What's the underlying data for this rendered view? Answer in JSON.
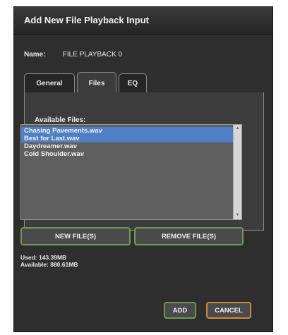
{
  "dialog": {
    "title": "Add New File Playback Input",
    "name_label": "Name:",
    "name_value": "FILE PLAYBACK 0",
    "tabs": [
      {
        "label": "General",
        "active": false
      },
      {
        "label": "Files",
        "active": true
      },
      {
        "label": "EQ",
        "active": false
      }
    ]
  },
  "files": {
    "available_label": "Available Files:",
    "items": [
      {
        "name": "Chasing Pavements.wav",
        "selected": true
      },
      {
        "name": "Best for Last.wav",
        "selected": true
      },
      {
        "name": "Daydreamer.wav",
        "selected": false
      },
      {
        "name": "Cold Shoulder.wav",
        "selected": false
      }
    ],
    "new_button": "NEW FILE(S)",
    "remove_button": "REMOVE FILE(S)",
    "used": "Used: 143.39MB",
    "available": "Available: 880.61MB"
  },
  "footer": {
    "add_button": "ADD",
    "cancel_button": "CANCEL"
  },
  "colors": {
    "selection": "#4f7fc4",
    "green_border": "#6f9a4f",
    "orange_border": "#d2873a"
  }
}
